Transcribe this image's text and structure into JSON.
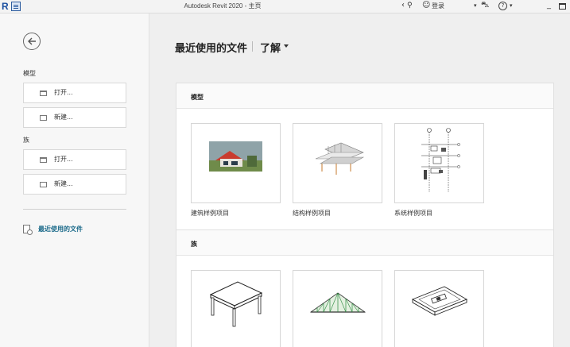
{
  "titlebar": {
    "app_letter": "R",
    "title": "Autodesk Revit 2020 - 主页",
    "sign_in": "登录",
    "help": "?"
  },
  "sidebar": {
    "model_label": "模型",
    "family_label": "族",
    "model_open": "打开...",
    "model_new": "新建...",
    "family_open": "打开...",
    "family_new": "新建...",
    "recent_files": "最近使用的文件"
  },
  "main": {
    "title": "最近使用的文件",
    "learn": "了解",
    "models_section": {
      "heading": "模型",
      "cards": [
        {
          "label": "建筑样例项目",
          "icon": "architectural-house-thumbnail"
        },
        {
          "label": "结构样例项目",
          "icon": "structural-frame-thumbnail"
        },
        {
          "label": "系统样例项目",
          "icon": "systems-drawing-thumbnail"
        }
      ]
    },
    "families_section": {
      "heading": "族",
      "cards": [
        {
          "icon": "table-family-thumbnail"
        },
        {
          "icon": "truss-family-thumbnail"
        },
        {
          "icon": "fixture-family-thumbnail"
        }
      ]
    }
  },
  "colors": {
    "accent_link": "#1b6a8a",
    "revit_blue": "#1b4fa0"
  }
}
